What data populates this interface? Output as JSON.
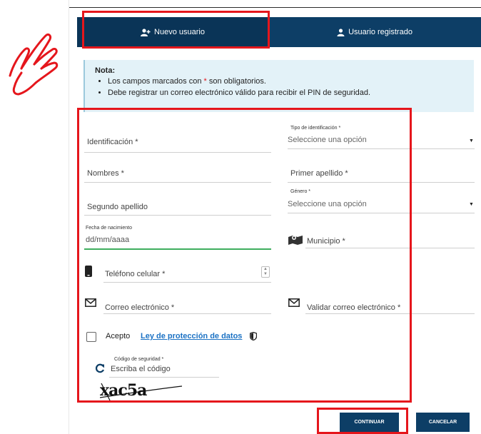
{
  "tabs": {
    "new_user": "Nuevo usuario",
    "registered_user": "Usuario registrado"
  },
  "note": {
    "title": "Nota:",
    "line1_before": "Los campos marcados con",
    "line1_mark": "*",
    "line1_after": "son obligatorios.",
    "line2": "Debe registrar un correo electrónico válido para recibir el PIN de seguridad."
  },
  "form": {
    "identificacion": "Identificación *",
    "tipo_id_label": "Tipo de identificación *",
    "tipo_id_value": "Seleccione una opción",
    "nombres": "Nombres *",
    "primer_apellido": "Primer apellido *",
    "genero_label": "Género *",
    "genero_value": "Seleccione una opción",
    "segundo_apellido": "Segundo apellido",
    "fecha_label": "Fecha de nacimiento",
    "fecha_placeholder": "dd/mm/aaaa",
    "municipio": "Municipio *",
    "telefono": "Teléfono celular *",
    "correo": "Correo electrónico *",
    "validar_correo": "Validar correo electrónico *",
    "acepto": "Acepto",
    "ley_link": "Ley de protección de datos",
    "codigo_label": "Código de seguridad *",
    "codigo_placeholder": "Escriba el código",
    "captcha_text": "xac5a"
  },
  "buttons": {
    "continuar": "CONTINUAR",
    "cancelar": "CANCELAR"
  },
  "colors": {
    "primary": "#0d3e66",
    "highlight": "#e5161c",
    "note_bg": "#e3f2f8",
    "link": "#1c72c4",
    "focus": "#3fae5e"
  }
}
